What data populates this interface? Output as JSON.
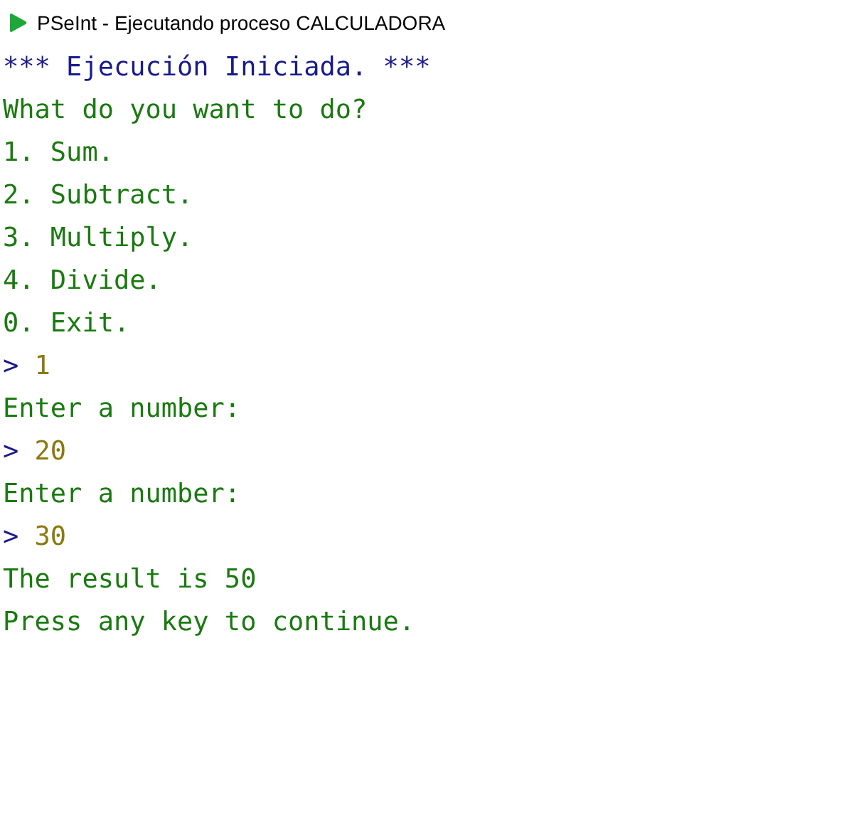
{
  "window": {
    "title": "PSeInt - Ejecutando proceso CALCULADORA"
  },
  "console": {
    "lines": [
      {
        "kind": "info",
        "text": "*** Ejecución Iniciada. ***"
      },
      {
        "kind": "output",
        "text": "What do you want to do?"
      },
      {
        "kind": "output",
        "text": "1. Sum."
      },
      {
        "kind": "output",
        "text": "2. Subtract."
      },
      {
        "kind": "output",
        "text": "3. Multiply."
      },
      {
        "kind": "output",
        "text": "4. Divide."
      },
      {
        "kind": "output",
        "text": "0. Exit."
      },
      {
        "kind": "input",
        "prompt": ">",
        "text": "1"
      },
      {
        "kind": "output",
        "text": "Enter a number:"
      },
      {
        "kind": "input",
        "prompt": ">",
        "text": "20"
      },
      {
        "kind": "output",
        "text": "Enter a number:"
      },
      {
        "kind": "input",
        "prompt": ">",
        "text": "30"
      },
      {
        "kind": "output",
        "text": "The result is 50"
      },
      {
        "kind": "output",
        "text": "Press any key to continue."
      }
    ]
  }
}
